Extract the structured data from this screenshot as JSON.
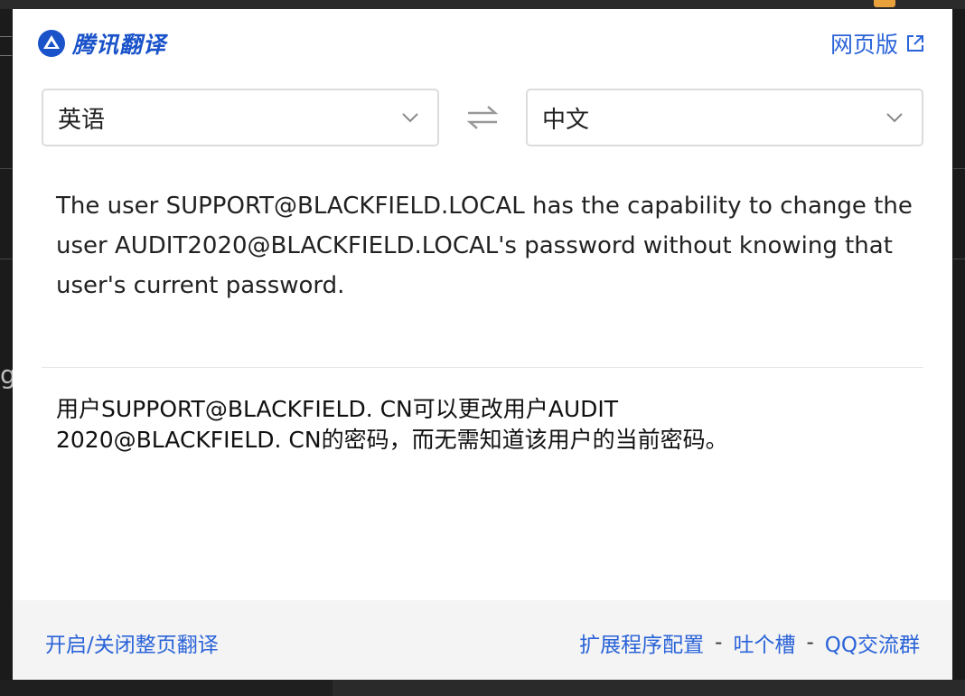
{
  "brand": {
    "name": "腾讯翻译",
    "logo_icon": "tencent-translate-logo",
    "color": "#1a52c9"
  },
  "header": {
    "web_version_label": "网页版",
    "web_version_icon": "external-link-icon"
  },
  "languages": {
    "source": "英语",
    "target": "中文",
    "swap_icon": "swap-arrows-icon"
  },
  "source_text": "The user SUPPORT@BLACKFIELD.LOCAL has the capability to change the user AUDIT2020@BLACKFIELD.LOCAL's password without knowing that user's current password.",
  "translation": {
    "line1": "用户SUPPORT@BLACKFIELD. CN可以更改用户AUDIT",
    "line2": "2020@BLACKFIELD. CN的密码，而无需知道该用户的当前密码。"
  },
  "footer": {
    "toggle_page_translate": "开启/关闭整页翻译",
    "extension_settings": "扩展程序配置",
    "separator": "-",
    "feedback": "吐个槽",
    "qq_group": "QQ交流群"
  },
  "colors": {
    "link": "#2a63d8",
    "footer_bg": "#f4f4f4",
    "border": "#dcdcdc"
  }
}
